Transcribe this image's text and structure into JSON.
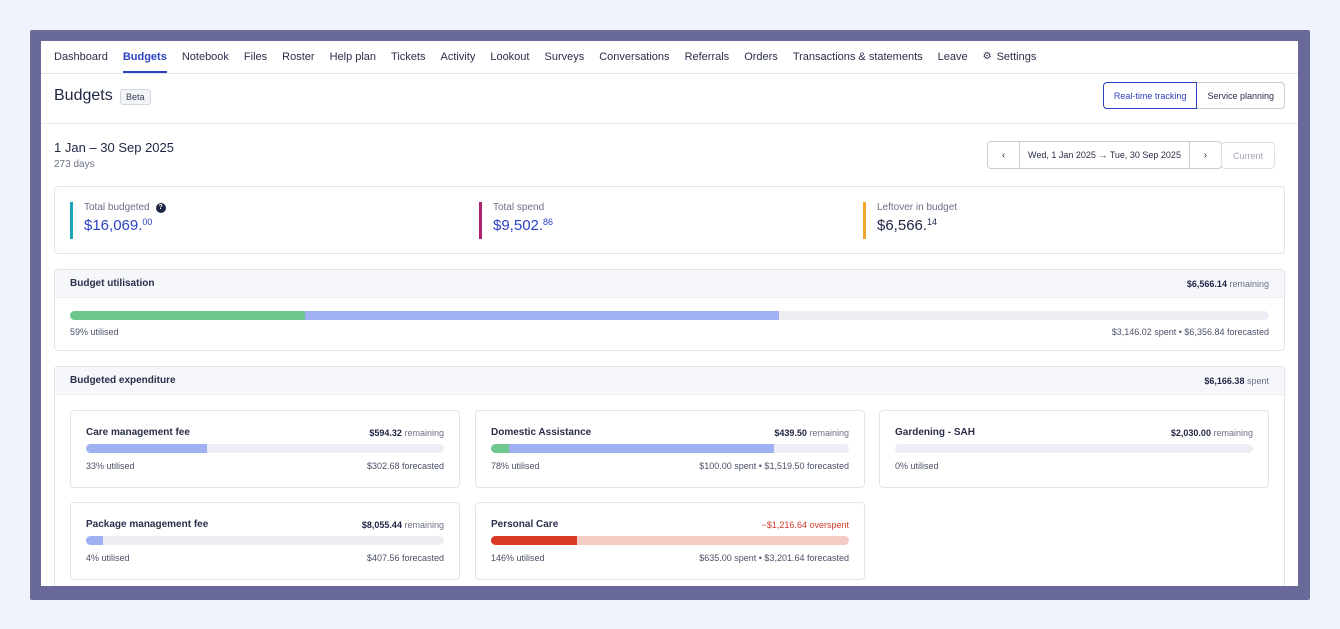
{
  "nav": {
    "items": [
      "Dashboard",
      "Budgets",
      "Notebook",
      "Files",
      "Roster",
      "Help plan",
      "Tickets",
      "Activity",
      "Lookout",
      "Surveys",
      "Conversations",
      "Referrals",
      "Orders",
      "Transactions & statements",
      "Leave"
    ],
    "settings_label": "Settings",
    "active": "Budgets"
  },
  "header": {
    "title": "Budgets",
    "badge": "Beta",
    "toggle": {
      "realtime": "Real-time tracking",
      "planning": "Service planning"
    }
  },
  "period": {
    "title": "1 Jan – 30 Sep 2025",
    "days": "273 days",
    "range_label": "Wed, 1 Jan 2025 → Tue, 30 Sep 2025",
    "prev_icon": "‹",
    "next_icon": "›",
    "current_label": "Current"
  },
  "summary": {
    "total_budgeted": {
      "label": "Total budgeted",
      "dollars": "$16,069.",
      "cents": "00",
      "color": "#1aa6b7"
    },
    "total_spend": {
      "label": "Total spend",
      "dollars": "$9,502.",
      "cents": "86",
      "color": "#b0226f"
    },
    "leftover": {
      "label": "Leftover in budget",
      "dollars": "$6,566.",
      "cents": "14",
      "color": "#f0a72b"
    },
    "help_icon": "?"
  },
  "utilisation": {
    "title": "Budget utilisation",
    "remaining_value": "$6,566.14",
    "remaining_word": "remaining",
    "utilised": "59% utilised",
    "detail": "$3,146.02 spent • $6,356.84 forecasted",
    "spent_fraction": 0.196,
    "forecast_fraction": 0.395
  },
  "expenditure": {
    "title": "Budgeted expenditure",
    "spent_value": "$6,166.38",
    "spent_word": "spent",
    "cards": [
      {
        "name": "Care management fee",
        "amount": "$594.32",
        "status": "remaining",
        "utilised": "33% utilised",
        "detail": "$302.68 forecasted",
        "spent": 0,
        "forecast": 0.338
      },
      {
        "name": "Domestic Assistance",
        "amount": "$439.50",
        "status": "remaining",
        "utilised": "78% utilised",
        "detail": "$100.00 spent • $1,519.50 forecasted",
        "spent": 0.05,
        "forecast": 0.74
      },
      {
        "name": "Gardening - SAH",
        "amount": "$2,030.00",
        "status": "remaining",
        "utilised": "0% utilised",
        "detail": "",
        "spent": 0,
        "forecast": 0
      },
      {
        "name": "Package management fee",
        "amount": "$8,055.44",
        "status": "remaining",
        "utilised": "4% utilised",
        "detail": "$407.56 forecasted",
        "spent": 0,
        "forecast": 0.048
      },
      {
        "name": "Personal Care",
        "amount": "−$1,216.64",
        "status": "overspent",
        "utilised": "146% utilised",
        "detail": "$635.00 spent • $3,201.64 forecasted",
        "spent": 0.24,
        "forecast": 1.0
      }
    ]
  },
  "colors": {
    "accent": "#2c43c2",
    "spent": "#6ec78d",
    "forecast": "#9fb1f2",
    "over": "#d93a26",
    "over_bg": "#f6cbc4"
  }
}
